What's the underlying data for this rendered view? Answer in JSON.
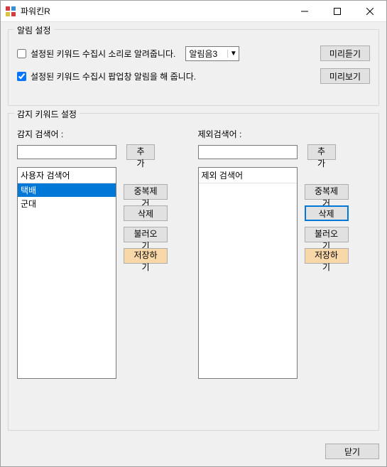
{
  "titlebar": {
    "title": "파워킨R"
  },
  "alarm": {
    "group_title": "알림 설정",
    "sound_checkbox_checked": false,
    "sound_label": "설정된 키워드 수집시 소리로 알려줍니다.",
    "sound_select_value": "알림음3",
    "preview_sound_button": "미리듣기",
    "popup_checkbox_checked": true,
    "popup_label": "설정된 키워드 수집시 팝업창 알림을 해 줍니다.",
    "preview_popup_button": "미리보기"
  },
  "keywords": {
    "group_title": "감지 키워드 설정",
    "include": {
      "label": "감지 검색어 :",
      "input_value": "",
      "add_button": "추가",
      "list_header": "사용자 검색어",
      "items": [
        "택배",
        "군대"
      ],
      "selected_index": 0,
      "dedup_button": "중복제거",
      "delete_button": "삭제",
      "load_button": "불러오기",
      "save_button": "저장하기"
    },
    "exclude": {
      "label": "제외검색어 :",
      "input_value": "",
      "add_button": "추가",
      "list_header": "제외 검색어",
      "items": [],
      "dedup_button": "중복제거",
      "delete_button": "삭제",
      "load_button": "불러오기",
      "save_button": "저장하기"
    }
  },
  "footer": {
    "close_button": "닫기"
  }
}
